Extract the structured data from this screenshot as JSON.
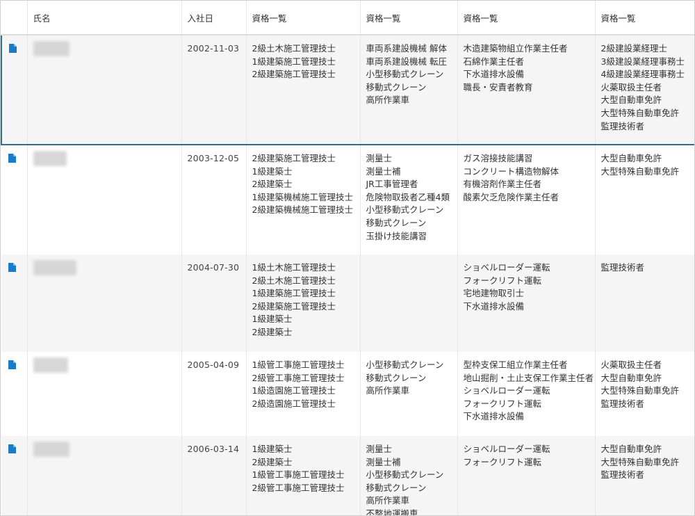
{
  "columns": {
    "icon": "",
    "name": "氏名",
    "hire_date": "入社日",
    "quals1": "資格一覧",
    "quals2": "資格一覧",
    "quals3": "資格一覧",
    "quals4": "資格一覧"
  },
  "colors": {
    "doc_icon": "#1a7cc9",
    "selected_border": "#2f6f8f",
    "alt_row": "#f5f5f5"
  },
  "rows": [
    {
      "icon": "document-icon",
      "hire_date": "2002-11-03",
      "quals1": [
        "2級土木施工管理技士",
        "1級建築施工管理技士",
        "2級建築施工管理技士"
      ],
      "quals2": [
        "車両系建設機械 解体",
        "車両系建設機械 転圧",
        "小型移動式クレーン",
        "移動式クレーン",
        "高所作業車"
      ],
      "quals3": [
        "木造建築物組立作業主任者",
        "石綿作業主任者",
        "下水道排水設備",
        "職長・安責者教育"
      ],
      "quals4": [
        "2級建設業経理士",
        "3級建設業経理事務士",
        "4級建設業経理事務士",
        "火薬取扱主任者",
        "大型自動車免許",
        "大型特殊自動車免許",
        "監理技術者"
      ]
    },
    {
      "icon": "document-icon",
      "hire_date": "2003-12-05",
      "quals1": [
        "2級建築施工管理技士",
        "1級建築士",
        "2級建築士",
        "1級建築機械施工管理技士",
        "2級建築機械施工管理技士"
      ],
      "quals2": [
        "測量士",
        "測量士補",
        "JR工事管理者",
        "危険物取扱者乙種4類",
        "小型移動式クレーン",
        "移動式クレーン",
        "玉掛け技能講習"
      ],
      "quals3": [
        "ガス溶接技能講習",
        "コンクリート構造物解体",
        "有機溶剤作業主任者",
        "酸素欠乏危険作業主任者"
      ],
      "quals4": [
        "大型自動車免許",
        "大型特殊自動車免許"
      ]
    },
    {
      "icon": "document-icon",
      "hire_date": "2004-07-30",
      "quals1": [
        "1級土木施工管理技士",
        "2級土木施工管理技士",
        "1級建築施工管理技士",
        "2級建築施工管理技士",
        "1級建築士",
        "2級建築士"
      ],
      "quals2": [],
      "quals3": [
        "ショベルローダー運転",
        "フォークリフト運転",
        "宅地建物取引士",
        "下水道排水設備"
      ],
      "quals4": [
        "監理技術者"
      ]
    },
    {
      "icon": "document-icon",
      "hire_date": "2005-04-09",
      "quals1": [
        "1級管工事施工管理技士",
        "2級管工事施工管理技士",
        "1級造園施工管理技士",
        "2級造園施工管理技士"
      ],
      "quals2": [
        "小型移動式クレーン",
        "移動式クレーン",
        "高所作業車"
      ],
      "quals3": [
        "型枠支保工組立作業主任者",
        "地山掘削・土止支保工作業主任者",
        "ショベルローダー運転",
        "フォークリフト運転",
        "下水道排水設備"
      ],
      "quals4": [
        "火薬取扱主任者",
        "大型自動車免許",
        "大型特殊自動車免許",
        "監理技術者"
      ]
    },
    {
      "icon": "document-icon",
      "hire_date": "2006-03-14",
      "quals1": [
        "1級建築士",
        "2級建築士",
        "1級管工事施工管理技士",
        "2級管工事施工管理技士"
      ],
      "quals2": [
        "測量士",
        "測量士補",
        "小型移動式クレーン",
        "移動式クレーン",
        "高所作業車",
        "不整地運搬車"
      ],
      "quals3": [
        "ショベルローダー運転",
        "フォークリフト運転"
      ],
      "quals4": [
        "大型自動車免許",
        "大型特殊自動車免許",
        "監理技術者"
      ]
    }
  ]
}
